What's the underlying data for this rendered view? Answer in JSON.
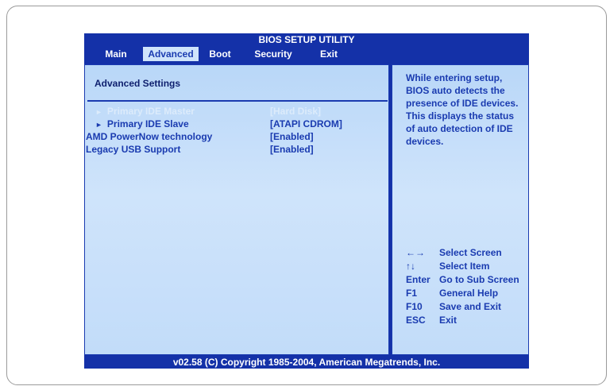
{
  "title": "BIOS SETUP UTILITY",
  "menu": [
    "Main",
    "Advanced",
    "Boot",
    "Security",
    "Exit"
  ],
  "active_menu": "Advanced",
  "section_title": "Advanced Settings",
  "settings": [
    {
      "label": "Primary IDE Master",
      "value": "[Hard Disk]",
      "arrow": true,
      "highlighted": true
    },
    {
      "label": "Primary IDE Slave",
      "value": "[ATAPI CDROM]",
      "arrow": true,
      "highlighted": false
    },
    {
      "label": "AMD PowerNow technology",
      "value": "[Enabled]",
      "arrow": false,
      "highlighted": false
    },
    {
      "label": "Legacy USB Support",
      "value": "[Enabled]",
      "arrow": false,
      "highlighted": false
    }
  ],
  "help_text": "While entering setup, BIOS auto detects the presence of IDE devices.  This displays the status of auto detection of IDE devices.",
  "keys": [
    {
      "key": "←→",
      "desc": "Select Screen"
    },
    {
      "key": "↑↓",
      "desc": "Select Item"
    },
    {
      "key": "Enter",
      "desc": "Go to Sub Screen"
    },
    {
      "key": "F1",
      "desc": "General Help"
    },
    {
      "key": "F10",
      "desc": "Save and Exit"
    },
    {
      "key": "ESC",
      "desc": "Exit"
    }
  ],
  "footer": "v02.58 (C) Copyright  1985-2004, American Megatrends, Inc.",
  "colors": {
    "bios_blue": "#1431a8",
    "panel_light": "#cfe4fb",
    "text_blue": "#1a3bb0"
  }
}
